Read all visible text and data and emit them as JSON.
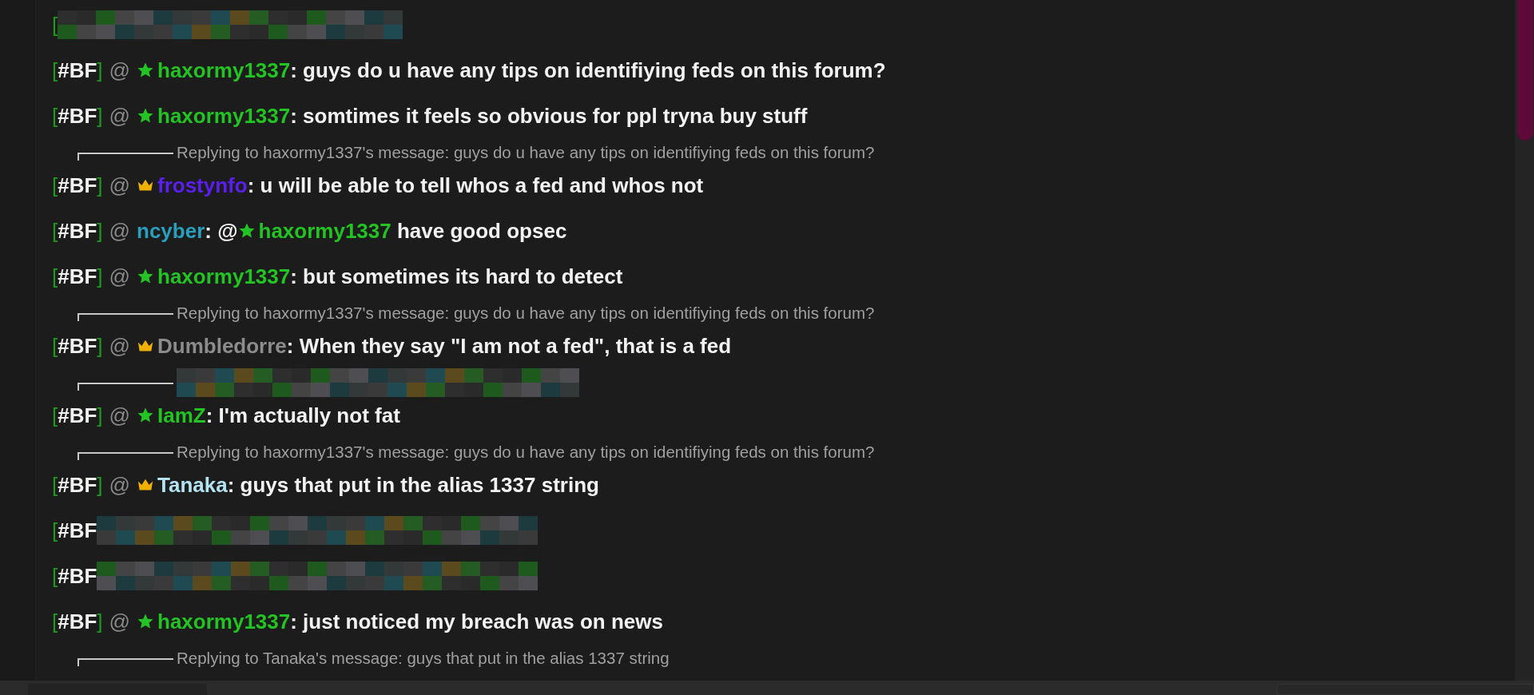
{
  "messages": [
    {
      "kind": "redacted",
      "open": "["
    },
    {
      "kind": "message",
      "open": "[",
      "tag": "#BF",
      "close": "]",
      "at": "@",
      "parts": [
        {
          "kind": "star_user",
          "name": "haxormy1337",
          "color": "#22c322"
        },
        {
          "kind": "text",
          "text": ": guys do u have any tips on identifiying feds on this forum?"
        }
      ]
    },
    {
      "kind": "message",
      "open": "[",
      "tag": "#BF",
      "close": "]",
      "at": "@",
      "parts": [
        {
          "kind": "star_user",
          "name": "haxormy1337",
          "color": "#22c322"
        },
        {
          "kind": "text",
          "text": ": somtimes it feels so obvious for ppl tryna buy stuff"
        }
      ]
    },
    {
      "kind": "reply",
      "text": "Replying to haxormy1337's message: guys do u have any tips on identifiying feds on this forum?"
    },
    {
      "kind": "message",
      "open": "[",
      "tag": "#BF",
      "close": "]",
      "at": "@",
      "parts": [
        {
          "kind": "crown_user",
          "name": "frostynfo",
          "color": "#5a1ff0"
        },
        {
          "kind": "text",
          "text": ": u will be able to tell whos a fed and whos not"
        }
      ]
    },
    {
      "kind": "message",
      "open": "[",
      "tag": "#BF",
      "close": "]",
      "at": "@",
      "parts": [
        {
          "kind": "user",
          "name": "ncyber",
          "color": "#2a9fbc"
        },
        {
          "kind": "text",
          "text": ": @"
        },
        {
          "kind": "star_user",
          "name": "haxormy1337",
          "color": "#22c322"
        },
        {
          "kind": "text",
          "text": " have good opsec"
        }
      ]
    },
    {
      "kind": "message",
      "open": "[",
      "tag": "#BF",
      "close": "]",
      "at": "@",
      "parts": [
        {
          "kind": "star_user",
          "name": "haxormy1337",
          "color": "#22c322"
        },
        {
          "kind": "text",
          "text": ": but sometimes its hard to detect"
        }
      ]
    },
    {
      "kind": "reply",
      "text": "Replying to haxormy1337's message: guys do u have any tips on identifiying feds on this forum?"
    },
    {
      "kind": "message",
      "open": "[",
      "tag": "#BF",
      "close": "]",
      "at": "@",
      "parts": [
        {
          "kind": "crown_user",
          "name": "Dumbledorre",
          "color": "#8c8c8c"
        },
        {
          "kind": "text",
          "text": ": When they say \"I am not a fed\", that is a fed"
        }
      ]
    },
    {
      "kind": "redacted_reply"
    },
    {
      "kind": "message",
      "open": "[",
      "tag": "#BF",
      "close": "]",
      "at": "@",
      "parts": [
        {
          "kind": "star_user",
          "name": "IamZ",
          "color": "#22c322"
        },
        {
          "kind": "text",
          "text": ": I'm actually not fat"
        }
      ]
    },
    {
      "kind": "reply",
      "text": "Replying to haxormy1337's message: guys do u have any tips on identifiying feds on this forum?"
    },
    {
      "kind": "message",
      "open": "[",
      "tag": "#BF",
      "close": "]",
      "at": "@",
      "parts": [
        {
          "kind": "crown_user",
          "name": "Tanaka",
          "color": "#b3e3f0"
        },
        {
          "kind": "text",
          "text": ": guys that put in the alias 1337 string"
        }
      ]
    },
    {
      "kind": "redacted",
      "open": "[",
      "tag": "#BF"
    },
    {
      "kind": "redacted",
      "open": "[",
      "tag": "#BF"
    },
    {
      "kind": "message",
      "open": "[",
      "tag": "#BF",
      "close": "]",
      "at": "@",
      "parts": [
        {
          "kind": "star_user",
          "name": "haxormy1337",
          "color": "#22c322"
        },
        {
          "kind": "text",
          "text": ": just noticed my breach was on news"
        }
      ]
    },
    {
      "kind": "reply",
      "text": "Replying to Tanaka's message: guys that put in the alias 1337 string"
    }
  ]
}
